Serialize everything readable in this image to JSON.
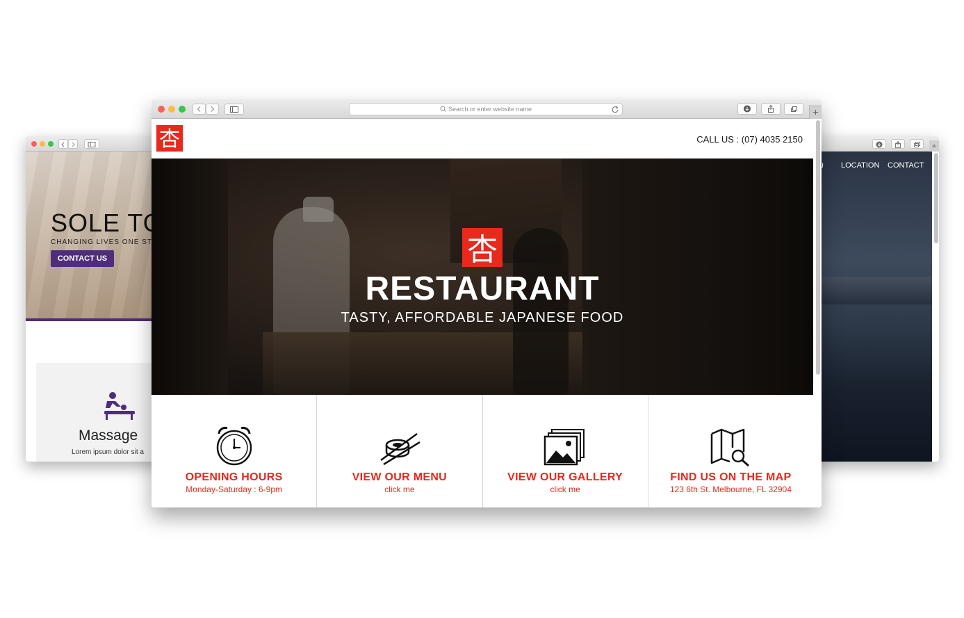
{
  "left_site": {
    "title": "SOLE TO",
    "subtitle": "CHANGING LIVES ONE STE",
    "contact_button": "CONTACT US",
    "service_label": "Massage",
    "service_text": "Lorem ipsum dolor sit a",
    "icons": [
      "massage-icon"
    ],
    "accent_color": "#4f2d7a"
  },
  "right_site": {
    "nav": {
      "partial": "U",
      "location": "LOCATION",
      "contact": "CONTACT"
    }
  },
  "browser": {
    "url_placeholder": "Search or enter website name",
    "new_tab": "+"
  },
  "restaurant": {
    "logo_glyph": "杏",
    "call_us": "CALL US : (07) 4035 2150",
    "hero_title": "RESTAURANT",
    "hero_subtitle": "TASTY, AFFORDABLE JAPANESE FOOD",
    "accent_color": "#e8291c",
    "features": [
      {
        "icon": "alarm-clock-icon",
        "title": "OPENING HOURS",
        "subtitle": "Monday-Saturday : 6-9pm"
      },
      {
        "icon": "sushi-chopsticks-icon",
        "title": "VIEW OUR MENU",
        "subtitle": "click me"
      },
      {
        "icon": "gallery-images-icon",
        "title": "VIEW OUR GALLERY",
        "subtitle": "click me"
      },
      {
        "icon": "map-search-icon",
        "title": "FIND US ON THE MAP",
        "subtitle": "123 6th St. Melbourne, FL 32904"
      }
    ]
  }
}
